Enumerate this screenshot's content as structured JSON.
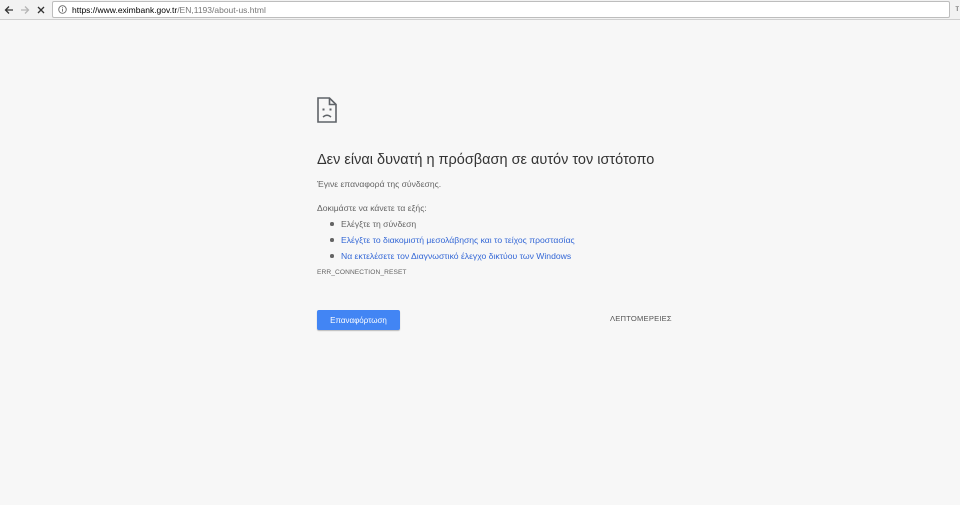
{
  "browser": {
    "url_host": "https://www.eximbank.gov.tr",
    "url_path": "/EN,1193/about-us.html",
    "edge_glyph": "т"
  },
  "error_page": {
    "heading": "Δεν είναι δυνατή η πρόσβαση σε αυτόν τον ιστότοπο",
    "subtext": "Έγινε επαναφορά της σύνδεσης.",
    "try_label": "Δοκιμάστε να κάνετε τα εξής:",
    "suggestions": [
      "Ελέγξτε τη σύνδεση",
      "Ελέγξτε το διακομιστή μεσολάβησης και το τείχος προστασίας",
      "Να εκτελέσετε τον Διαγνωστικό έλεγχο δικτύου των Windows"
    ],
    "error_code": "ERR_CONNECTION_RESET",
    "reload_label": "Επαναφόρτωση",
    "details_label": "ΛΕΠΤΟΜΕΡΕΙΕΣ"
  },
  "icons": {
    "back": "back-arrow-icon",
    "forward": "forward-arrow-icon",
    "stop": "stop-icon",
    "info": "info-icon",
    "sad_page": "sad-page-icon"
  },
  "colors": {
    "page_background": "#f7f7f7",
    "link": "#3367d6",
    "button": "#4285f4",
    "heading_text": "#333333",
    "body_text": "#646464"
  }
}
